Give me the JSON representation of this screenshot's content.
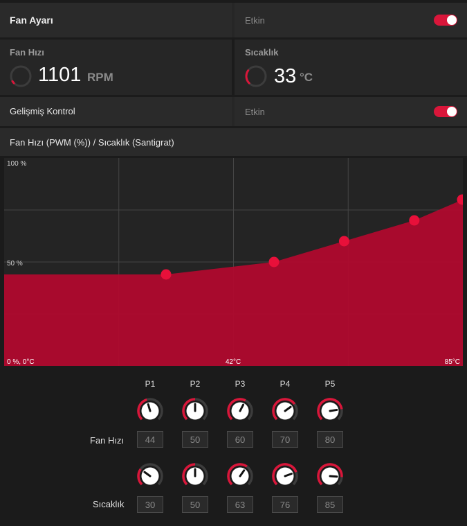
{
  "fan_settings": {
    "title": "Fan Ayarı",
    "status": "Etkin",
    "enabled": true
  },
  "fan_speed": {
    "label": "Fan Hızı",
    "value": "1101",
    "unit": "RPM",
    "gauge_fraction": 0.05
  },
  "temperature": {
    "label": "Sıcaklık",
    "value": "33",
    "unit": "°C",
    "gauge_fraction": 0.3
  },
  "advanced_control": {
    "label": "Gelişmiş Kontrol",
    "status": "Etkin",
    "enabled": true
  },
  "curve_header": {
    "title": "Fan Hızı (PWM (%)) / Sıcaklık (Santigrat)"
  },
  "chart_data": {
    "type": "area",
    "x_label_min": "0 %, 0°C",
    "x_label_mid": "42°C",
    "x_label_max": "85°C",
    "y_label_top": "100 %",
    "y_label_mid": "50 %",
    "xlim": [
      0,
      85
    ],
    "ylim": [
      0,
      100
    ],
    "x": [
      0,
      30,
      50,
      63,
      76,
      85
    ],
    "y": [
      44,
      44,
      50,
      60,
      70,
      80
    ],
    "points": [
      {
        "temp": 30,
        "speed": 44
      },
      {
        "temp": 50,
        "speed": 50
      },
      {
        "temp": 63,
        "speed": 60
      },
      {
        "temp": 76,
        "speed": 70
      },
      {
        "temp": 85,
        "speed": 80
      }
    ],
    "color": "#b00a2e",
    "point_color": "#e8103a"
  },
  "points_table": {
    "headers": [
      "P1",
      "P2",
      "P3",
      "P4",
      "P5"
    ],
    "fan_speed_label": "Fan Hızı",
    "temperature_label": "Sıcaklık",
    "fan_speed_values": [
      "44",
      "50",
      "60",
      "70",
      "80"
    ],
    "temperature_values": [
      "30",
      "50",
      "63",
      "76",
      "85"
    ]
  },
  "colors": {
    "accent": "#d9163a",
    "fill": "#b00a2e",
    "background": "#1b1b1b"
  }
}
